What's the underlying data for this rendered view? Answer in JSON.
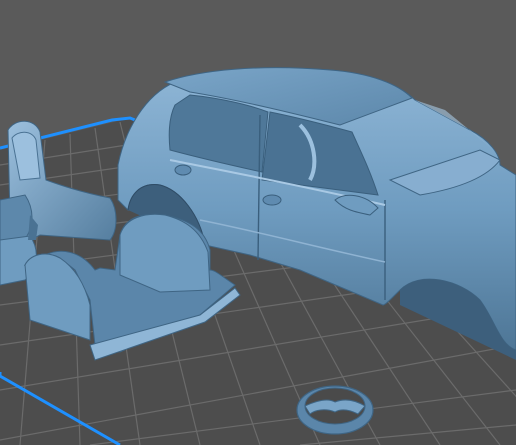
{
  "viewport": {
    "background": "#5a5a5a",
    "grid_color": "#4a4a4a",
    "grid_line_color": "#6e6e6e",
    "bed_border_color": "#1e90ff",
    "model_color": "#6f9cc0",
    "model_shadow_color": "#3e5f7c",
    "model_highlight_color": "#a9c9e4"
  },
  "objects": [
    {
      "kind": "car-body",
      "icon": "car-shell-model"
    },
    {
      "kind": "seats",
      "icon": "seat-model"
    },
    {
      "kind": "floor-pan",
      "icon": "floor-pan-model"
    },
    {
      "kind": "steering-wheel",
      "icon": "steering-wheel-model"
    }
  ]
}
